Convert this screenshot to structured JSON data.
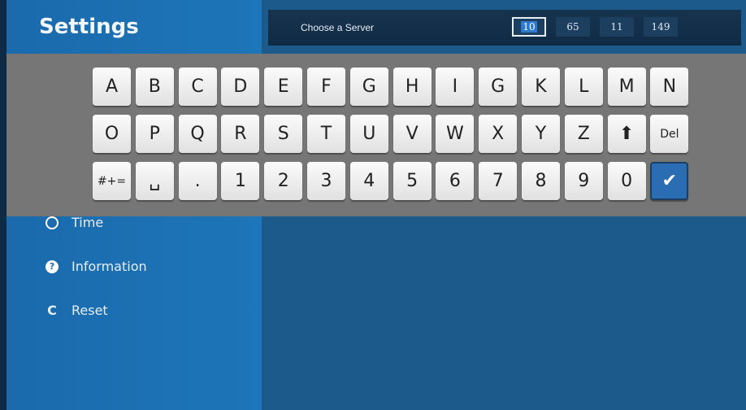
{
  "sidebar": {
    "title": "Settings",
    "items": [
      {
        "label": "Time",
        "icon": "clock-icon",
        "glyph": "◔"
      },
      {
        "label": "Information",
        "icon": "info-icon",
        "glyph": "?"
      },
      {
        "label": "Reset",
        "icon": "reset-icon",
        "glyph": "C"
      }
    ]
  },
  "server": {
    "label": "Choose a Server",
    "octets": [
      "10",
      "65",
      "11",
      "149"
    ],
    "active_octet": 0
  },
  "keyboard": {
    "row1": [
      "A",
      "B",
      "C",
      "D",
      "E",
      "F",
      "G",
      "H",
      "I",
      "G",
      "K",
      "L",
      "M",
      "N"
    ],
    "row2": [
      "O",
      "P",
      "Q",
      "R",
      "S",
      "T",
      "U",
      "V",
      "W",
      "X",
      "Y",
      "Z",
      "⬆",
      "Del"
    ],
    "row3": [
      "#+=",
      "␣",
      ".",
      "1",
      "2",
      "3",
      "4",
      "5",
      "6",
      "7",
      "8",
      "9",
      "0",
      "✔"
    ]
  },
  "colors": {
    "sidebar": "#1d70b3",
    "main": "#1c5a8c",
    "keyboard_overlay": "#767676",
    "confirm_key": "#2a6db3"
  }
}
